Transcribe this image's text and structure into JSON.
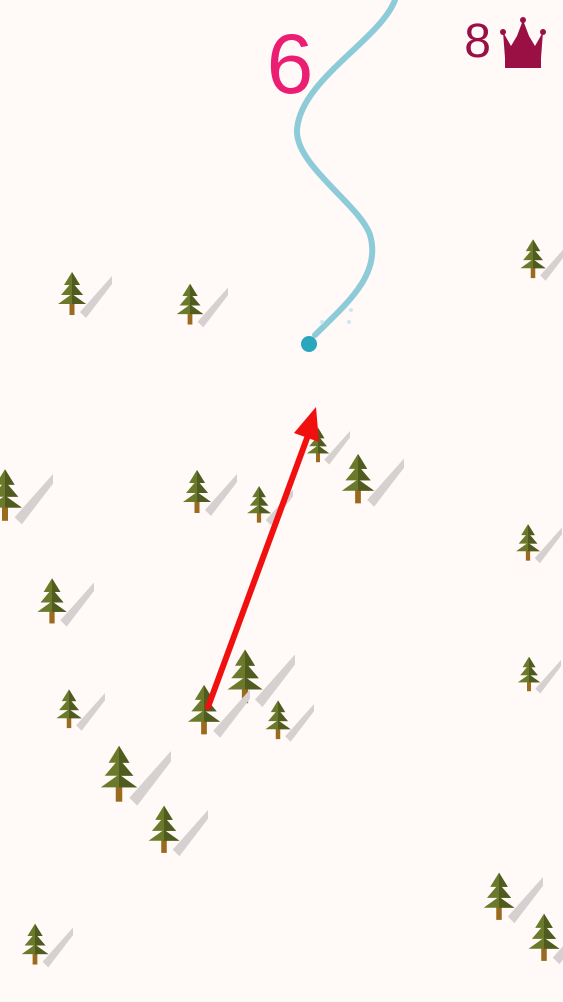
{
  "hud": {
    "score": "6",
    "best_score": "8",
    "best_icon": "crown-icon"
  },
  "colors": {
    "background": "#fff9f7",
    "score": "#ea1f74",
    "best": "#9a1045",
    "trail": "#8ecbd8",
    "skier": "#2aa6bd",
    "arrow": "#f01010",
    "tree_dark": "#4f5b1f",
    "tree_light": "#6b7a2a",
    "trunk": "#9a6a1e",
    "shadow": "#d6d1d0"
  },
  "swipe_hint": {
    "icon": "swipe-arrow-icon",
    "direction": "up-right"
  }
}
